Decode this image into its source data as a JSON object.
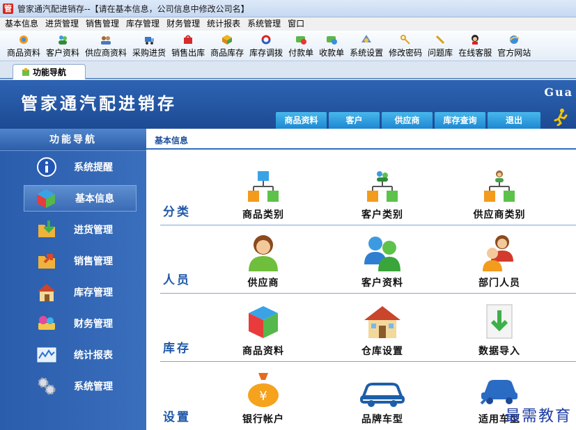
{
  "window": {
    "title": "管家通汽配进销存--【请在基本信息，公司信息中修改公司名】",
    "app_icon_glyph": "管"
  },
  "menu": [
    "基本信息",
    "进货管理",
    "销售管理",
    "库存管理",
    "财务管理",
    "统计报表",
    "系统管理",
    "窗口"
  ],
  "toolbar": [
    {
      "label": "商品资料",
      "icon": "product-icon"
    },
    {
      "label": "客户资料",
      "icon": "customer-icon"
    },
    {
      "label": "供应商资料",
      "icon": "supplier-icon"
    },
    {
      "label": "采购进货",
      "icon": "purchase-icon"
    },
    {
      "label": "销售出库",
      "icon": "sales-icon"
    },
    {
      "label": "商品库存",
      "icon": "stock-icon"
    },
    {
      "label": "库存调拨",
      "icon": "transfer-icon"
    },
    {
      "label": "付款单",
      "icon": "payment-icon"
    },
    {
      "label": "收款单",
      "icon": "receipt-icon"
    },
    {
      "label": "系统设置",
      "icon": "settings-icon"
    },
    {
      "label": "修改密码",
      "icon": "password-icon"
    },
    {
      "label": "问题库",
      "icon": "faq-icon"
    },
    {
      "label": "在线客服",
      "icon": "support-icon"
    },
    {
      "label": "官方网站",
      "icon": "website-icon"
    }
  ],
  "tab": {
    "label": "功能导航"
  },
  "banner": {
    "title": "管家通汽配进销存",
    "latin": "Gua",
    "nav": [
      "商品资料",
      "客户",
      "供应商",
      "库存查询",
      "退出"
    ]
  },
  "sidebar": {
    "header": "功能导航",
    "items": [
      {
        "label": "系统提醒",
        "icon": "info-icon",
        "active": false
      },
      {
        "label": "基本信息",
        "icon": "cube-icon",
        "active": true
      },
      {
        "label": "进货管理",
        "icon": "folder-in-icon",
        "active": false
      },
      {
        "label": "销售管理",
        "icon": "folder-out-icon",
        "active": false
      },
      {
        "label": "库存管理",
        "icon": "house-icon",
        "active": false
      },
      {
        "label": "财务管理",
        "icon": "money-icon",
        "active": false
      },
      {
        "label": "统计报表",
        "icon": "chart-icon",
        "active": false
      },
      {
        "label": "系统管理",
        "icon": "gears-icon",
        "active": false
      }
    ]
  },
  "main": {
    "breadcrumb": "基本信息",
    "sections": [
      {
        "label": "分类",
        "modules": [
          {
            "label": "商品类别",
            "icon": "category-tree-icon"
          },
          {
            "label": "客户类别",
            "icon": "customer-tree-icon"
          },
          {
            "label": "供应商类别",
            "icon": "supplier-tree-icon"
          }
        ]
      },
      {
        "label": "人员",
        "modules": [
          {
            "label": "供应商",
            "icon": "person-icon"
          },
          {
            "label": "客户资料",
            "icon": "people-icon"
          },
          {
            "label": "部门人员",
            "icon": "staff-icon"
          }
        ]
      },
      {
        "label": "库存",
        "modules": [
          {
            "label": "商品资料",
            "icon": "boxes-icon"
          },
          {
            "label": "仓库设置",
            "icon": "warehouse-icon"
          },
          {
            "label": "数据导入",
            "icon": "import-icon"
          }
        ]
      },
      {
        "label": "设置",
        "modules": [
          {
            "label": "银行帐户",
            "icon": "money-bag-icon"
          },
          {
            "label": "品牌车型",
            "icon": "car-icon"
          },
          {
            "label": "适用车型",
            "icon": "car-tool-icon"
          }
        ]
      }
    ]
  },
  "watermark": "最需教育",
  "colors": {
    "banner": "#2558a6",
    "sidebar": "#2f63b0",
    "navtab": "#2a9ae0",
    "section_label": "#1f58a8"
  }
}
